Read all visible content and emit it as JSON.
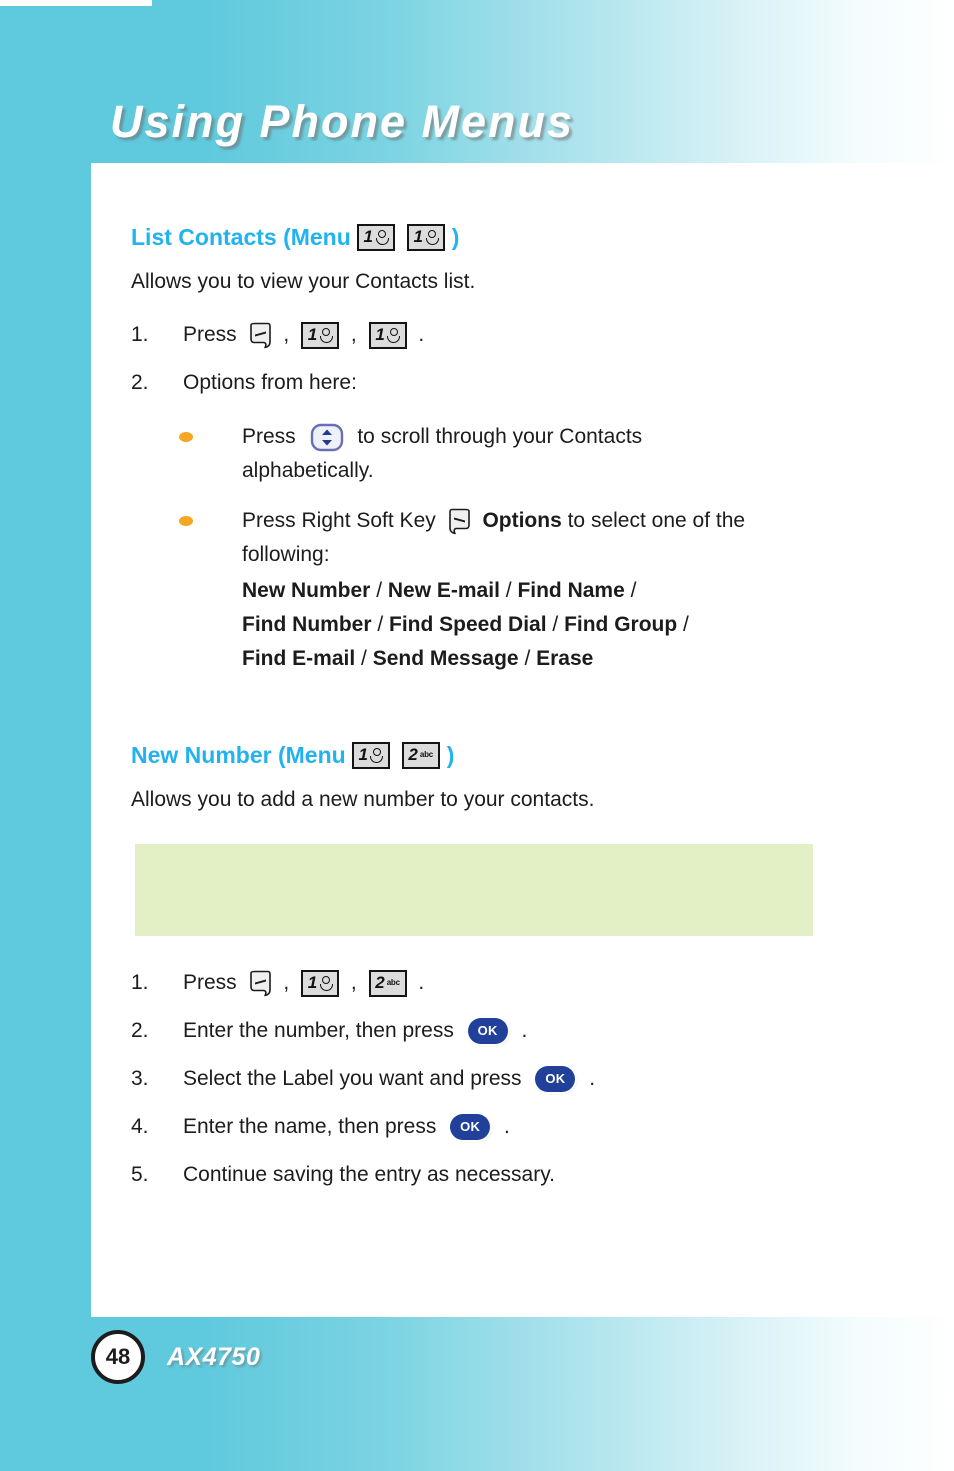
{
  "header": {
    "chapter_title": "Using Phone Menus"
  },
  "colors": {
    "heading_blue": "#22b3ef",
    "bullet_orange": "#f5a623",
    "note_box_green": "#e3f0c6",
    "ok_key_blue": "#21409a",
    "band_cyan": "#5fc9dd"
  },
  "sections": [
    {
      "heading_prefix": "List Contacts (Menu",
      "heading_keys": [
        {
          "digit": "1",
          "sub": "voicemail"
        },
        {
          "digit": "1",
          "sub": "voicemail"
        }
      ],
      "heading_suffix": ")",
      "intro": "Allows you to view your Contacts list.",
      "steps": [
        {
          "num": "1.",
          "parts": [
            {
              "type": "text",
              "value": "Press "
            },
            {
              "type": "softkey",
              "dir": "left"
            },
            {
              "type": "text",
              "value": " , "
            },
            {
              "type": "key",
              "digit": "1",
              "sub": "voicemail"
            },
            {
              "type": "text",
              "value": " , "
            },
            {
              "type": "key",
              "digit": "1",
              "sub": "voicemail"
            },
            {
              "type": "text",
              "value": " ."
            }
          ]
        },
        {
          "num": "2.",
          "parts": [
            {
              "type": "text",
              "value": "Options from here:"
            }
          ]
        }
      ],
      "bullets": [
        {
          "parts": [
            {
              "type": "text",
              "value": "Press "
            },
            {
              "type": "navkey"
            },
            {
              "type": "text",
              "value": " to scroll through your Contacts"
            }
          ],
          "continuation": "alphabetically."
        },
        {
          "parts": [
            {
              "type": "text",
              "value": "Press Right Soft Key "
            },
            {
              "type": "softkey",
              "dir": "right"
            },
            {
              "type": "text",
              "value": " "
            },
            {
              "type": "bold",
              "value": "Options"
            },
            {
              "type": "text",
              "value": " to select one of the"
            }
          ],
          "continuation": "following:",
          "options_lines": [
            [
              "New Number",
              "New E-mail",
              "Find Name",
              ""
            ],
            [
              "Find Number",
              "Find Speed Dial",
              "Find Group",
              ""
            ],
            [
              "Find E-mail",
              "Send Message",
              "Erase"
            ]
          ]
        }
      ]
    },
    {
      "heading_prefix": "New Number (Menu",
      "heading_keys": [
        {
          "digit": "1",
          "sub": "voicemail"
        },
        {
          "digit": "2",
          "sub": "abc"
        }
      ],
      "heading_suffix": ")",
      "intro": "Allows you to add a new number to your contacts.",
      "note_box": "",
      "steps": [
        {
          "num": "1.",
          "parts": [
            {
              "type": "text",
              "value": "Press "
            },
            {
              "type": "softkey",
              "dir": "left"
            },
            {
              "type": "text",
              "value": " , "
            },
            {
              "type": "key",
              "digit": "1",
              "sub": "voicemail"
            },
            {
              "type": "text",
              "value": " , "
            },
            {
              "type": "key",
              "digit": "2",
              "sub": "abc"
            },
            {
              "type": "text",
              "value": " ."
            }
          ]
        },
        {
          "num": "2.",
          "parts": [
            {
              "type": "text",
              "value": "Enter the number, then press "
            },
            {
              "type": "okkey",
              "label": "OK"
            },
            {
              "type": "text",
              "value": " ."
            }
          ]
        },
        {
          "num": "3.",
          "parts": [
            {
              "type": "text",
              "value": "Select the Label you want and press "
            },
            {
              "type": "okkey",
              "label": "OK"
            },
            {
              "type": "text",
              "value": " ."
            }
          ]
        },
        {
          "num": "4.",
          "parts": [
            {
              "type": "text",
              "value": "Enter the name, then press "
            },
            {
              "type": "okkey",
              "label": "OK"
            },
            {
              "type": "text",
              "value": " ."
            }
          ]
        },
        {
          "num": "5.",
          "parts": [
            {
              "type": "text",
              "value": "Continue saving the entry as necessary."
            }
          ]
        }
      ]
    }
  ],
  "footer": {
    "page_number": "48",
    "model_name": "AX4750"
  }
}
